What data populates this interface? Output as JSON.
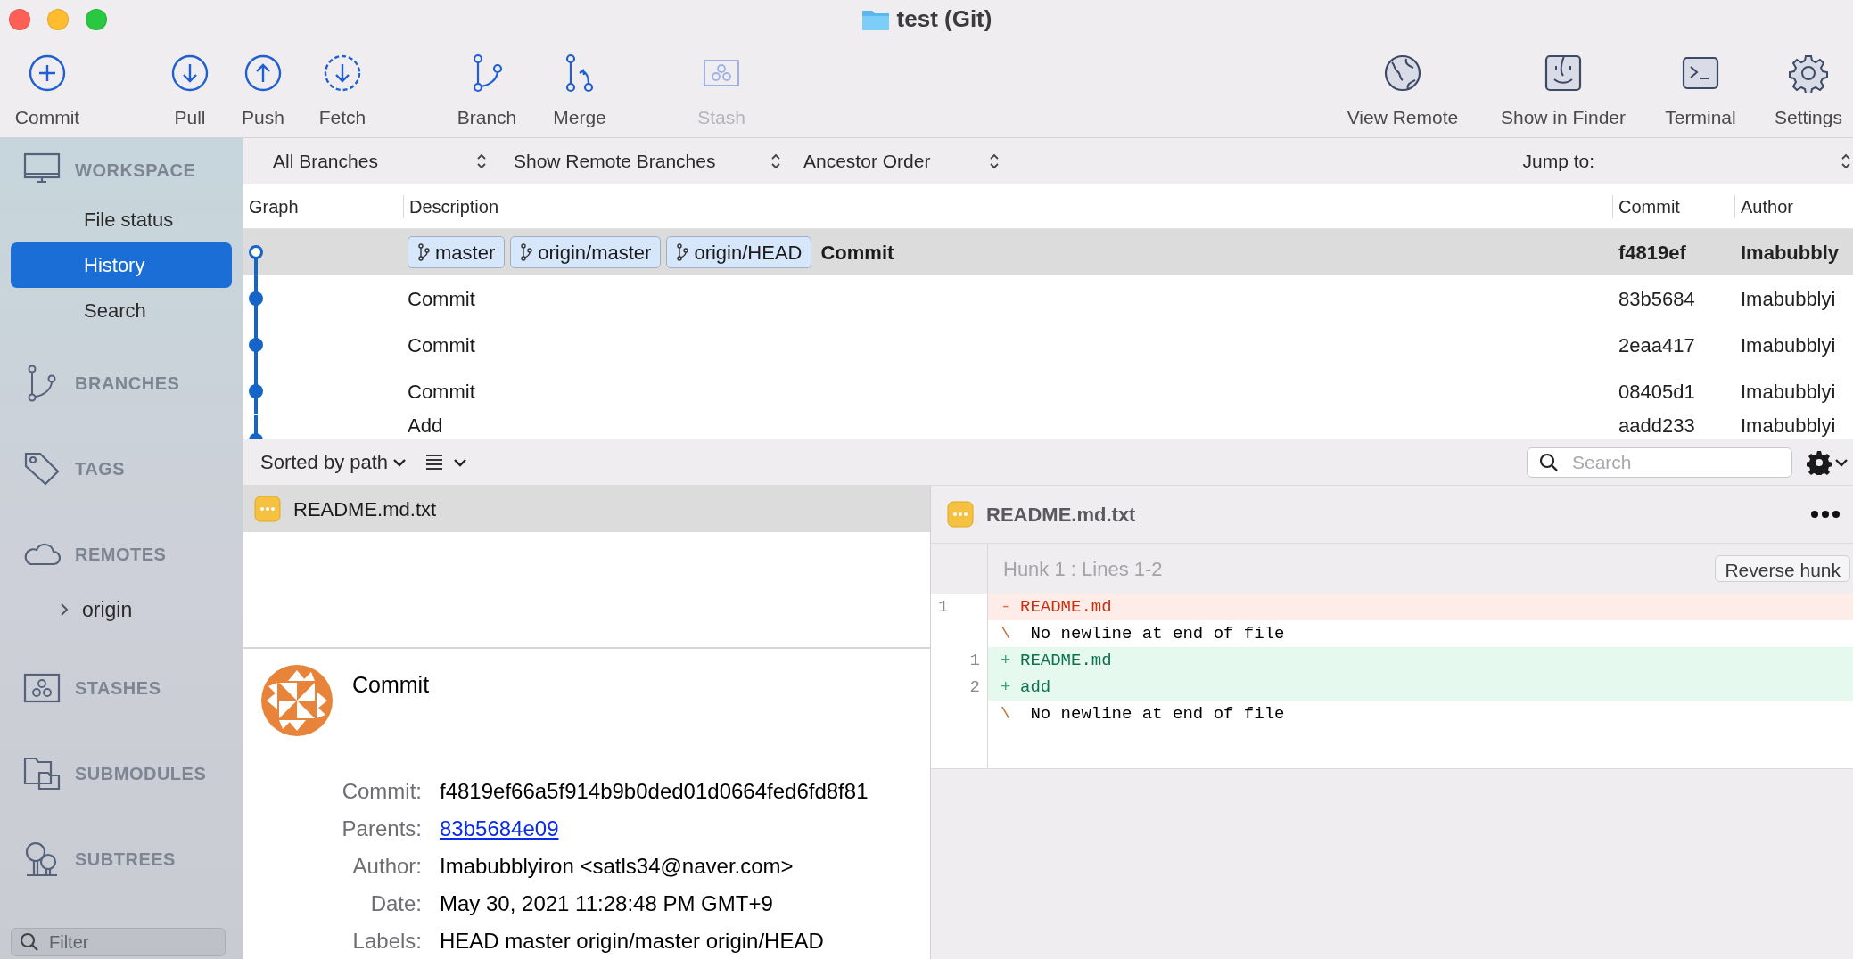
{
  "window": {
    "title": "test (Git)"
  },
  "toolbar": {
    "left": [
      {
        "kind": "commit",
        "label": "Commit",
        "disabled": false
      },
      {
        "kind": "pull",
        "label": "Pull",
        "disabled": false
      },
      {
        "kind": "push",
        "label": "Push",
        "disabled": false
      },
      {
        "kind": "fetch",
        "label": "Fetch",
        "disabled": false
      },
      {
        "kind": "branch",
        "label": "Branch",
        "disabled": false
      },
      {
        "kind": "merge",
        "label": "Merge",
        "disabled": false
      },
      {
        "kind": "stash",
        "label": "Stash",
        "disabled": true
      }
    ],
    "right": [
      {
        "kind": "remote",
        "label": "View Remote",
        "disabled": false
      },
      {
        "kind": "finder",
        "label": "Show in Finder",
        "disabled": false
      },
      {
        "kind": "terminal",
        "label": "Terminal",
        "disabled": false
      },
      {
        "kind": "settings",
        "label": "Settings",
        "disabled": false
      }
    ]
  },
  "sidebar": {
    "sections": [
      {
        "kind": "workspace",
        "label": "WORKSPACE",
        "items": [
          {
            "label": "File status",
            "selected": false
          },
          {
            "label": "History",
            "selected": true
          },
          {
            "label": "Search",
            "selected": false
          }
        ]
      },
      {
        "kind": "branches",
        "label": "BRANCHES"
      },
      {
        "kind": "tags",
        "label": "TAGS"
      },
      {
        "kind": "remotes",
        "label": "REMOTES",
        "items": [
          {
            "label": "origin",
            "expanded": false
          }
        ]
      },
      {
        "kind": "stashes",
        "label": "STASHES"
      },
      {
        "kind": "submodules",
        "label": "SUBMODULES"
      },
      {
        "kind": "subtrees",
        "label": "SUBTREES"
      }
    ],
    "filter": {
      "placeholder": "Filter"
    }
  },
  "filters": {
    "selects": [
      "All Branches",
      "Show Remote Branches",
      "Ancestor Order"
    ],
    "jump_to": "Jump to:"
  },
  "table": {
    "columns": [
      "Graph",
      "Description",
      "Commit",
      "Author"
    ],
    "rows": [
      {
        "labels": [
          "master",
          "origin/master",
          "origin/HEAD"
        ],
        "description": "Commit",
        "commit": "f4819ef",
        "author": "Imabubbly",
        "selected": true,
        "current": true
      },
      {
        "description": "Commit",
        "commit": "83b5684",
        "author": "Imabubblyi",
        "selected": false,
        "current": false
      },
      {
        "description": "Commit",
        "commit": "2eaa417",
        "author": "Imabubblyi",
        "selected": false,
        "current": false
      },
      {
        "description": "Commit",
        "commit": "08405d1",
        "author": "Imabubblyi",
        "selected": false,
        "current": false
      },
      {
        "description": "Add",
        "commit": "aadd233",
        "author": "Imabubblyi",
        "selected": false,
        "current": false
      }
    ]
  },
  "files_toolbar": {
    "sort": "Sorted by path",
    "search": {
      "placeholder": "Search"
    }
  },
  "files": [
    {
      "name": "README.md.txt",
      "selected": true
    }
  ],
  "commit_details": {
    "message": "Commit",
    "fields": [
      {
        "label": "Commit:",
        "value": "f4819ef66a5f914b9b0ded01d0664fed6fd8f81",
        "kind": "text"
      },
      {
        "label": "Parents:",
        "value": "83b5684e09",
        "kind": "link"
      },
      {
        "label": "Author:",
        "value": "Imabubblyiron <satls34@naver.com>",
        "kind": "text"
      },
      {
        "label": "Date:",
        "value": "May 30, 2021 11:28:48 PM GMT+9",
        "kind": "text"
      },
      {
        "label": "Labels:",
        "value": "HEAD master origin/master origin/HEAD",
        "kind": "text"
      }
    ]
  },
  "diff": {
    "file": "README.md.txt",
    "hunk": {
      "title": "Hunk 1 : Lines 1-2",
      "button": "Reverse hunk"
    },
    "lines": [
      {
        "kind": "removed",
        "old": "1",
        "sign": "-",
        "text": "README.md"
      },
      {
        "kind": "note",
        "sign": "\\",
        "text": " No newline at end of file"
      },
      {
        "kind": "added",
        "new": "1",
        "sign": "+",
        "text": "README.md"
      },
      {
        "kind": "added",
        "new": "2",
        "sign": "+",
        "text": "add"
      },
      {
        "kind": "note",
        "sign": "\\",
        "text": " No newline at end of file"
      }
    ]
  }
}
